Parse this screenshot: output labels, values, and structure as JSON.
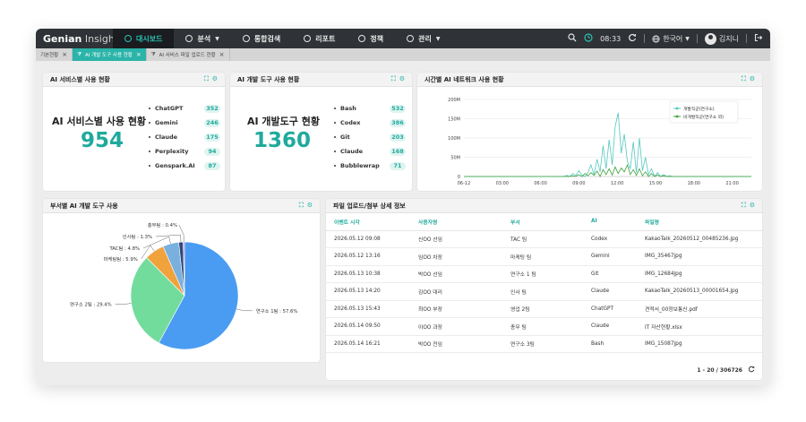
{
  "app": {
    "logo_bold": "Genian",
    "logo_light": " Insights E"
  },
  "nav": [
    {
      "label": "대시보드",
      "icon": "dashboard-icon",
      "active": true
    },
    {
      "label": "분석",
      "icon": "analysis-icon",
      "caret": true
    },
    {
      "label": "통합검색",
      "icon": "search-doc-icon"
    },
    {
      "label": "리포트",
      "icon": "report-icon"
    },
    {
      "label": "정책",
      "icon": "policy-icon"
    },
    {
      "label": "관리",
      "icon": "settings-icon",
      "caret": true
    }
  ],
  "topright": {
    "time": "08:33",
    "language": "한국어",
    "user": "김지니"
  },
  "tabs": [
    {
      "label": "기본현황",
      "active": false
    },
    {
      "label": "AI 개발 도구 사용 현황",
      "active": true
    },
    {
      "label": "AI 서비스 파일 업로드 현황",
      "active": false
    }
  ],
  "panel_service": {
    "title": "AI 서비스별 사용 현황",
    "big_title": "AI 서비스별 사용 현황",
    "total": "954",
    "items": [
      {
        "name": "ChatGPT",
        "value": "352"
      },
      {
        "name": "Gemini",
        "value": "246"
      },
      {
        "name": "Claude",
        "value": "175"
      },
      {
        "name": "Perplexity",
        "value": "94"
      },
      {
        "name": "Genspark.AI",
        "value": "87"
      }
    ]
  },
  "panel_devtool": {
    "title": "AI 개발 도구 사용 현황",
    "big_title": "AI 개발도구 현황",
    "total": "1360",
    "items": [
      {
        "name": "Bash",
        "value": "532"
      },
      {
        "name": "Codex",
        "value": "386"
      },
      {
        "name": "Git",
        "value": "203"
      },
      {
        "name": "Claude",
        "value": "168"
      },
      {
        "name": "Bubblewrap",
        "value": "71"
      }
    ]
  },
  "panel_network": {
    "title": "시간별 AI 네트워크 사용 현황"
  },
  "panel_dept": {
    "title": "부서별 AI 개발 도구 사용"
  },
  "panel_files": {
    "title": "파일 업로드/첨부 상세 정보",
    "columns": [
      "이벤트 시각",
      "사용자명",
      "부서",
      "AI",
      "파일명"
    ],
    "rows": [
      [
        "2026.05.12 09:08",
        "신OO 선임",
        "TAC 팀",
        "Codex",
        "KakaoTalk_20260512_00485236.jpg"
      ],
      [
        "2026.05.12 13:16",
        "임OO 차장",
        "마케팅 팀",
        "Gemini",
        "IMG_35467jpg"
      ],
      [
        "2026.05.13 10:38",
        "박OO 선임",
        "연구소 1 팀",
        "Git",
        "IMG_12684jpg"
      ],
      [
        "2026.05.13 14:20",
        "김OO 대리",
        "인사 팀",
        "Claude",
        "KakaoTalk_20260513_00001654.jpg"
      ],
      [
        "2026.05.13 15:43",
        "최OO 부장",
        "영업 2팀",
        "ChatGPT",
        "견적서_00정보통신.pdf"
      ],
      [
        "2026.05.14 09:50",
        "이OO 과장",
        "총무 팀",
        "Claude",
        "IT 자산현황.xlsx"
      ],
      [
        "2026.05.14 16:21",
        "박OO 전임",
        "연구소 3팀",
        "Bash",
        "IMG_15087jpg"
      ]
    ],
    "pager": "1 - 20 / 306726"
  },
  "chart_data": [
    {
      "type": "line",
      "title": "",
      "x": [
        "06-12",
        "03:00",
        "06:00",
        "09:00",
        "12:00",
        "15:00",
        "18:00",
        "21:00"
      ],
      "ylim": [
        0,
        200
      ],
      "yticks": [
        "0",
        "50M",
        "100M",
        "150M",
        "200M"
      ],
      "legend_position": "top-right",
      "grid": true,
      "series": [
        {
          "name": "개발직군(연구소)",
          "color": "#52c7c0",
          "values": [
            0,
            0,
            0,
            0,
            0,
            0,
            0,
            0,
            0,
            0,
            0,
            0,
            0,
            0,
            0,
            0,
            0,
            0,
            0,
            0,
            0,
            0,
            0,
            0,
            0,
            0,
            0,
            0,
            0,
            0,
            0,
            0,
            0,
            0,
            3,
            0,
            8,
            2,
            15,
            4,
            0,
            10,
            30,
            5,
            45,
            12,
            80,
            20,
            95,
            30,
            130,
            165,
            60,
            110,
            40,
            20,
            90,
            10,
            100,
            15,
            50,
            5,
            20,
            0,
            10,
            0,
            5,
            0,
            2,
            0,
            0,
            0,
            0,
            0,
            0,
            0,
            0,
            0,
            0,
            0,
            0,
            0,
            0,
            0,
            0,
            0,
            0,
            0,
            0,
            0,
            0,
            0,
            0,
            0,
            0,
            0
          ]
        },
        {
          "name": "비개발직군(연구소 외)",
          "color": "#3da23d",
          "values": [
            0,
            0,
            0,
            0,
            0,
            0,
            0,
            0,
            0,
            0,
            0,
            0,
            0,
            0,
            0,
            0,
            0,
            0,
            0,
            0,
            0,
            0,
            0,
            0,
            0,
            0,
            0,
            0,
            0,
            0,
            0,
            0,
            0,
            0,
            0,
            0,
            2,
            0,
            5,
            0,
            8,
            2,
            10,
            3,
            14,
            0,
            18,
            5,
            20,
            4,
            25,
            8,
            22,
            12,
            30,
            5,
            18,
            3,
            20,
            2,
            12,
            0,
            8,
            0,
            4,
            0,
            2,
            0,
            0,
            0,
            0,
            0,
            0,
            0,
            0,
            0,
            0,
            0,
            0,
            0,
            0,
            0,
            0,
            0,
            0,
            0,
            0,
            0,
            0,
            0,
            0,
            0,
            0,
            0,
            0,
            0
          ]
        }
      ]
    },
    {
      "type": "pie",
      "slices": [
        {
          "label": "연구소 1팀",
          "value": 57.6,
          "color": "#4a9cf2"
        },
        {
          "label": "연구소 2팀",
          "value": 29.4,
          "color": "#72dc9c"
        },
        {
          "label": "마케팅팀",
          "value": 5.9,
          "color": "#f0a23c"
        },
        {
          "label": "TAC팀",
          "value": 4.8,
          "color": "#7ab0dd"
        },
        {
          "label": "인사팀",
          "value": 1.3,
          "color": "#2d4a7a"
        },
        {
          "label": "총무팀",
          "value": 0.4,
          "color": "#b97ad6"
        }
      ],
      "labels_text": [
        "연구소 1팀 : 57.6%",
        "연구소 2팀 : 29.4%",
        "마케팅팀 : 5.9%",
        "TAC팀 : 4.8%",
        "인사팀 : 1.3%",
        "총무팀 : 0.4%"
      ]
    }
  ]
}
